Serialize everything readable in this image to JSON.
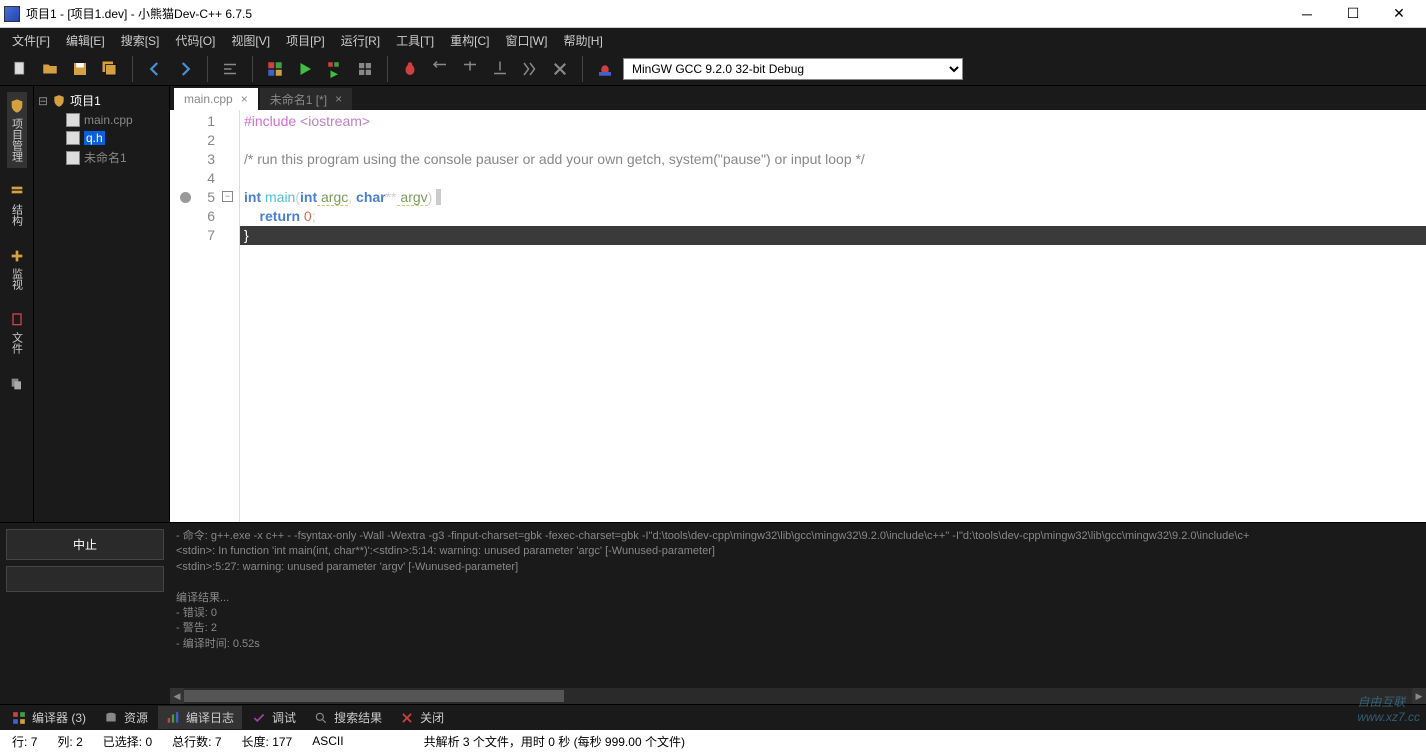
{
  "window": {
    "title": "项目1 - [项目1.dev] - 小熊猫Dev-C++ 6.7.5"
  },
  "menu": {
    "file": "文件[F]",
    "edit": "编辑[E]",
    "search": "搜索[S]",
    "code": "代码[O]",
    "view": "视图[V]",
    "project": "项目[P]",
    "run": "运行[R]",
    "tools": "工具[T]",
    "refactor": "重构[C]",
    "window": "窗口[W]",
    "help": "帮助[H]"
  },
  "toolbar": {
    "compiler_selected": "MinGW GCC 9.2.0 32-bit Debug"
  },
  "sidebar": {
    "project_manage": "项目管理",
    "structure": "结构",
    "watch": "监视",
    "files": "文件"
  },
  "tree": {
    "project": "项目1",
    "files": [
      "main.cpp",
      "q.h",
      "未命名1"
    ]
  },
  "tabs": {
    "tab1": "main.cpp",
    "tab2": "未命名1 [*]"
  },
  "code": {
    "l1_a": "#include ",
    "l1_b": "<iostream>",
    "l3": "/* run this program using the console pauser or add your own getch, system(\"pause\") or input loop */",
    "l5_int": "int",
    "l5_main": " main",
    "l5_p1": "(",
    "l5_int2": "int",
    "l5_argc": " argc",
    "l5_c": ", ",
    "l5_char": "char",
    "l5_star": "**",
    "l5_argv": " argv",
    "l5_p2": ") ",
    "l5_brace": "{",
    "l6_a": "    return ",
    "l6_b": "0",
    "l6_c": ";",
    "l7": "}"
  },
  "bottom_left": {
    "stop": "中止"
  },
  "compiler_output": {
    "l1": "- 命令: g++.exe -x c++ - -fsyntax-only -Wall -Wextra -g3 -finput-charset=gbk -fexec-charset=gbk -I\"d:\\tools\\dev-cpp\\mingw32\\lib\\gcc\\mingw32\\9.2.0\\include\\c++\" -I\"d:\\tools\\dev-cpp\\mingw32\\lib\\gcc\\mingw32\\9.2.0\\include\\c+",
    "l2": "<stdin>: In function 'int main(int, char**)':<stdin>:5:14: warning: unused parameter 'argc' [-Wunused-parameter]",
    "l3": "<stdin>:5:27: warning: unused parameter 'argv' [-Wunused-parameter]",
    "l5": "编译结果...",
    "l6": "- 错误: 0",
    "l7": "- 警告: 2",
    "l8": "- 编译时间: 0.52s"
  },
  "bottom_tabs": {
    "compiler": "编译器 (3)",
    "resources": "资源",
    "log": "编译日志",
    "debug": "调试",
    "search": "搜索结果",
    "close": "关闭"
  },
  "status": {
    "line": "行:",
    "line_v": "7",
    "col": "列:",
    "col_v": "2",
    "sel": "已选择:",
    "sel_v": "0",
    "total": "总行数:",
    "total_v": "7",
    "len": "长度:",
    "len_v": "177",
    "enc": "ASCII",
    "parse": "共解析 3 个文件，用时 0 秒 (每秒 999.00 个文件)"
  },
  "watermark": {
    "l1": "自由互联",
    "l2": "www.xz7.cc"
  }
}
